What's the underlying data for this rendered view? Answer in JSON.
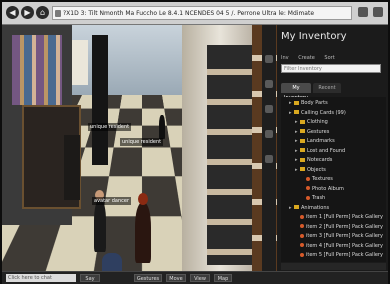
{
  "browser": {
    "address": "?X1D 3: Tilt Nmonth Ma Fuccho Le 8.4.1 NCENDES 04 5 /. Perrone Ultra le: Mdimate"
  },
  "scene": {
    "name_tags": [
      "unique resident",
      "unique resident",
      "avatar dancer"
    ]
  },
  "inventory": {
    "title": "My Inventory",
    "menu": [
      "Inv",
      "Create",
      "Sort"
    ],
    "filter_placeholder": "Filter Inventory",
    "tabs": [
      "My Inventory",
      "Recent"
    ],
    "rows": [
      {
        "type": "folder",
        "label": "Body Parts",
        "depth": 1
      },
      {
        "type": "folder",
        "label": "Calling Cards (99)",
        "depth": 1
      },
      {
        "type": "folder",
        "label": "Clothing",
        "depth": 2
      },
      {
        "type": "folder",
        "label": "Gestures",
        "depth": 2
      },
      {
        "type": "folder",
        "label": "Landmarks",
        "depth": 2
      },
      {
        "type": "folder",
        "label": "Lost and Found",
        "depth": 2
      },
      {
        "type": "folder",
        "label": "Notecards",
        "depth": 2
      },
      {
        "type": "folder",
        "label": "Objects",
        "depth": 2
      },
      {
        "type": "item",
        "label": "Textures",
        "depth": 3
      },
      {
        "type": "item",
        "label": "Photo Album",
        "depth": 3
      },
      {
        "type": "item",
        "label": "Trash",
        "depth": 3
      },
      {
        "type": "folder",
        "label": "Animations",
        "depth": 1
      },
      {
        "type": "item",
        "label": "item 1 [Full Perm] Pack Gallery",
        "depth": 2
      },
      {
        "type": "item",
        "label": "item 2 [Full Perm] Pack Gallery",
        "depth": 2
      },
      {
        "type": "item",
        "label": "item 3 [Full Perm] Pack Gallery",
        "depth": 2
      },
      {
        "type": "item",
        "label": "item 4 [Full Perm] Pack Gallery",
        "depth": 2
      },
      {
        "type": "item",
        "label": "item 5 [Full Perm] Pack Gallery",
        "depth": 2
      }
    ]
  },
  "toolbar": {
    "chat_placeholder": "Click here to chat",
    "buttons": [
      "Say",
      "Gestures",
      "Move",
      "View",
      "Map"
    ]
  }
}
